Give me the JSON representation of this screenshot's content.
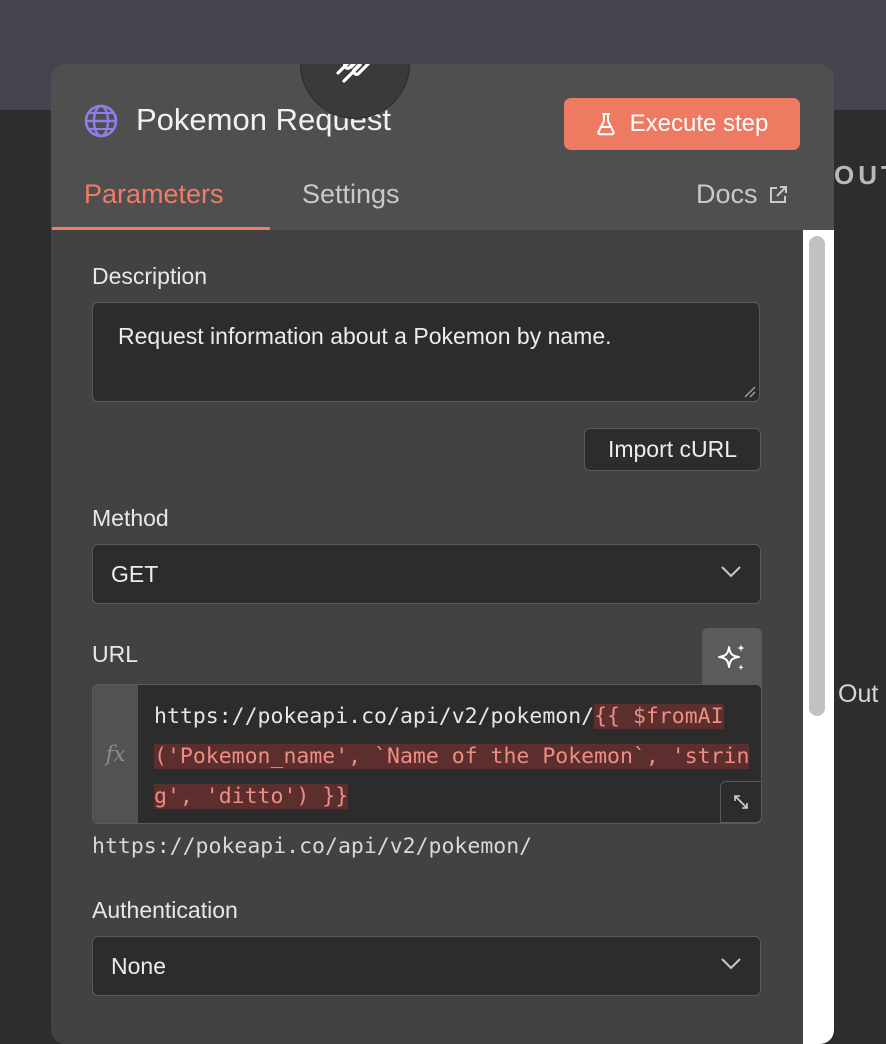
{
  "node": {
    "title": "Pokemon Request",
    "execute_label": "Execute step",
    "icon": "http-request-icon"
  },
  "tabs": [
    {
      "label": "Parameters",
      "active": true
    },
    {
      "label": "Settings",
      "active": false
    }
  ],
  "docs": {
    "label": "Docs",
    "icon": "external-link-icon"
  },
  "fields": {
    "description": {
      "label": "Description",
      "value": "Request information about a Pokemon by name."
    },
    "import_curl_label": "Import cURL",
    "method": {
      "label": "Method",
      "value": "GET"
    },
    "url": {
      "label": "URL",
      "fx_label": "fx",
      "static_part": "https://pokeapi.co/api/v2/pokemon/",
      "expression_part": "{{ $fromAI('Pokemon_name', `Name of the Pokemon`, 'string', 'ditto') }}",
      "preview": "https://pokeapi.co/api/v2/pokemon/"
    },
    "authentication": {
      "label": "Authentication",
      "value": "None"
    }
  },
  "background": {
    "output_heading": "OUTP",
    "output_label": "Out"
  },
  "colors": {
    "accent": "#ee7a62",
    "panel": "#424243",
    "header": "#4f4f50",
    "input_bg": "#2c2c2d",
    "expression_bg": "#5c2e2e",
    "expression_text": "#ec8e84"
  }
}
